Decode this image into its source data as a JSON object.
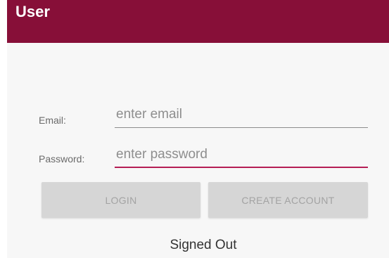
{
  "app_bar": {
    "title": "User",
    "color": "#870f38"
  },
  "form": {
    "email": {
      "label": "Email:",
      "value": "",
      "placeholder": "enter email"
    },
    "password": {
      "label": "Password:",
      "value": "",
      "placeholder": "enter password",
      "focused": true
    },
    "accent_color": "#b51e55"
  },
  "buttons": {
    "login": "LOGIN",
    "create_account": "CREATE ACCOUNT"
  },
  "status": {
    "text": "Signed Out"
  }
}
